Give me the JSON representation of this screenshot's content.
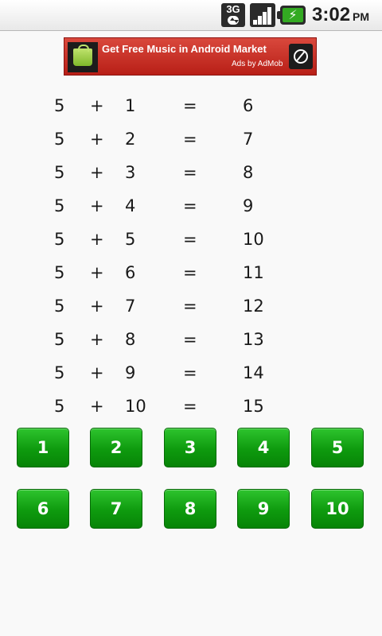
{
  "status_bar": {
    "network": "3G",
    "time": "3:02",
    "ampm": "PM",
    "icons": [
      "3g-data-icon",
      "signal-strength-icon",
      "battery-charging-icon"
    ]
  },
  "ad": {
    "title": "Get Free Music in Android Market",
    "subtitle": "Ads by AdMob",
    "icons": [
      "market-bag-icon",
      "compass-icon"
    ],
    "colors": {
      "background": "#c8281e"
    }
  },
  "equations": [
    {
      "a": "5",
      "op": "+",
      "b": "1",
      "eq": "=",
      "result": "6"
    },
    {
      "a": "5",
      "op": "+",
      "b": "2",
      "eq": "=",
      "result": "7"
    },
    {
      "a": "5",
      "op": "+",
      "b": "3",
      "eq": "=",
      "result": "8"
    },
    {
      "a": "5",
      "op": "+",
      "b": "4",
      "eq": "=",
      "result": "9"
    },
    {
      "a": "5",
      "op": "+",
      "b": "5",
      "eq": "=",
      "result": "10"
    },
    {
      "a": "5",
      "op": "+",
      "b": "6",
      "eq": "=",
      "result": "11"
    },
    {
      "a": "5",
      "op": "+",
      "b": "7",
      "eq": "=",
      "result": "12"
    },
    {
      "a": "5",
      "op": "+",
      "b": "8",
      "eq": "=",
      "result": "13"
    },
    {
      "a": "5",
      "op": "+",
      "b": "9",
      "eq": "=",
      "result": "14"
    },
    {
      "a": "5",
      "op": "+",
      "b": "10",
      "eq": "=",
      "result": "15"
    }
  ],
  "buttons": [
    "1",
    "2",
    "3",
    "4",
    "5",
    "6",
    "7",
    "8",
    "9",
    "10"
  ],
  "colors": {
    "button_green": "#109e10",
    "text": "#1a1a1a"
  }
}
